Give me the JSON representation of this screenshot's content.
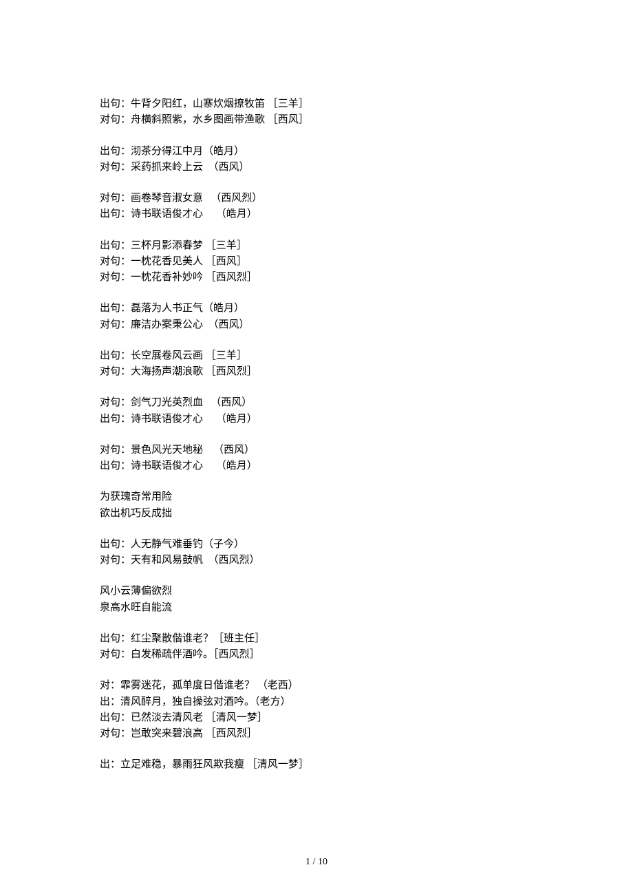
{
  "groups": [
    {
      "lines": [
        {
          "label": "出句：",
          "text": "牛背夕阳红，山寨炊烟撩牧笛 ",
          "author": "［三羊］"
        },
        {
          "label": "对句：",
          "text": "舟横斜照紫，水乡图画带渔歌 ",
          "author": "［西风］"
        }
      ]
    },
    {
      "lines": [
        {
          "label": "出句：",
          "text": "沏茶分得江中月",
          "author": "（皓月）"
        },
        {
          "label": "对句：",
          "text": "采药抓来岭上云  ",
          "author": "（西风）"
        }
      ]
    },
    {
      "lines": [
        {
          "label": "对句：",
          "text": "画卷琴音淑女意   ",
          "author": "（西风烈）"
        },
        {
          "label": "出句：",
          "text": "诗书联语俊才心     ",
          "author": "（皓月）"
        }
      ]
    },
    {
      "lines": [
        {
          "label": "出句：",
          "text": "三杯月影添春梦 ",
          "author": "［三羊］"
        },
        {
          "label": "对句：",
          "text": "一枕花香见美人 ",
          "author": "［西风］"
        },
        {
          "label": "对句：",
          "text": "一枕花香补妙吟 ",
          "author": "［西风烈］"
        }
      ]
    },
    {
      "lines": [
        {
          "label": "出句：",
          "text": "磊落为人书正气",
          "author": "（皓月）"
        },
        {
          "label": "对句：",
          "text": "廉洁办案秉公心  ",
          "author": "（西风）"
        }
      ]
    },
    {
      "lines": [
        {
          "label": "出句：",
          "text": "长空展卷风云画 ",
          "author": "［三羊］"
        },
        {
          "label": "对句：",
          "text": "大海扬声潮浪歌 ",
          "author": "［西风烈］"
        }
      ]
    },
    {
      "lines": [
        {
          "label": "对句：",
          "text": "剑气刀光英烈血   ",
          "author": "（西风）"
        },
        {
          "label": "出句：",
          "text": "诗书联语俊才心     ",
          "author": "（皓月）"
        }
      ]
    },
    {
      "lines": [
        {
          "label": "对句：",
          "text": "景色风光天地秘    ",
          "author": "（西风）"
        },
        {
          "label": "出句：",
          "text": "诗书联语俊才心     ",
          "author": "（皓月）"
        }
      ]
    },
    {
      "lines": [
        {
          "label": "",
          "text": "为获瑰奇常用险",
          "author": ""
        },
        {
          "label": "",
          "text": "欲出机巧反成拙",
          "author": ""
        }
      ]
    },
    {
      "lines": [
        {
          "label": "出句：",
          "text": "人无静气难垂钓",
          "author": "（子今）"
        },
        {
          "label": "对句：",
          "text": "天有和风易鼓帆  ",
          "author": "（西风烈）"
        }
      ]
    },
    {
      "lines": [
        {
          "label": "",
          "text": "风小云薄偏欲烈",
          "author": ""
        },
        {
          "label": "",
          "text": "泉高水旺自能流",
          "author": ""
        }
      ]
    },
    {
      "lines": [
        {
          "label": "出句：",
          "text": "红尘聚散偕谁老？",
          "author": "［班主任］"
        },
        {
          "label": "对句：",
          "text": "白发稀疏伴酒吟。",
          "author": "［西风烈］"
        }
      ]
    },
    {
      "lines": [
        {
          "label": "对：",
          "text": "霏雾迷花，孤单度日偕谁老？ ",
          "author": "（老西）"
        },
        {
          "label": "出：",
          "text": "清风醉月，独自操弦对酒吟。",
          "author": "（老方）"
        },
        {
          "label": "出句：",
          "text": "已然淡去清风老 ",
          "author": "［清风一梦］"
        },
        {
          "label": "对句：",
          "text": "岂敢突来碧浪高 ",
          "author": "［西风烈］"
        }
      ]
    },
    {
      "lines": [
        {
          "label": "出：",
          "text": "立足难稳，暴雨狂风欺我瘦 ",
          "author": "［清风一梦］"
        }
      ]
    }
  ],
  "footer": {
    "page_current": "1",
    "page_sep": " / ",
    "page_total": "10"
  }
}
